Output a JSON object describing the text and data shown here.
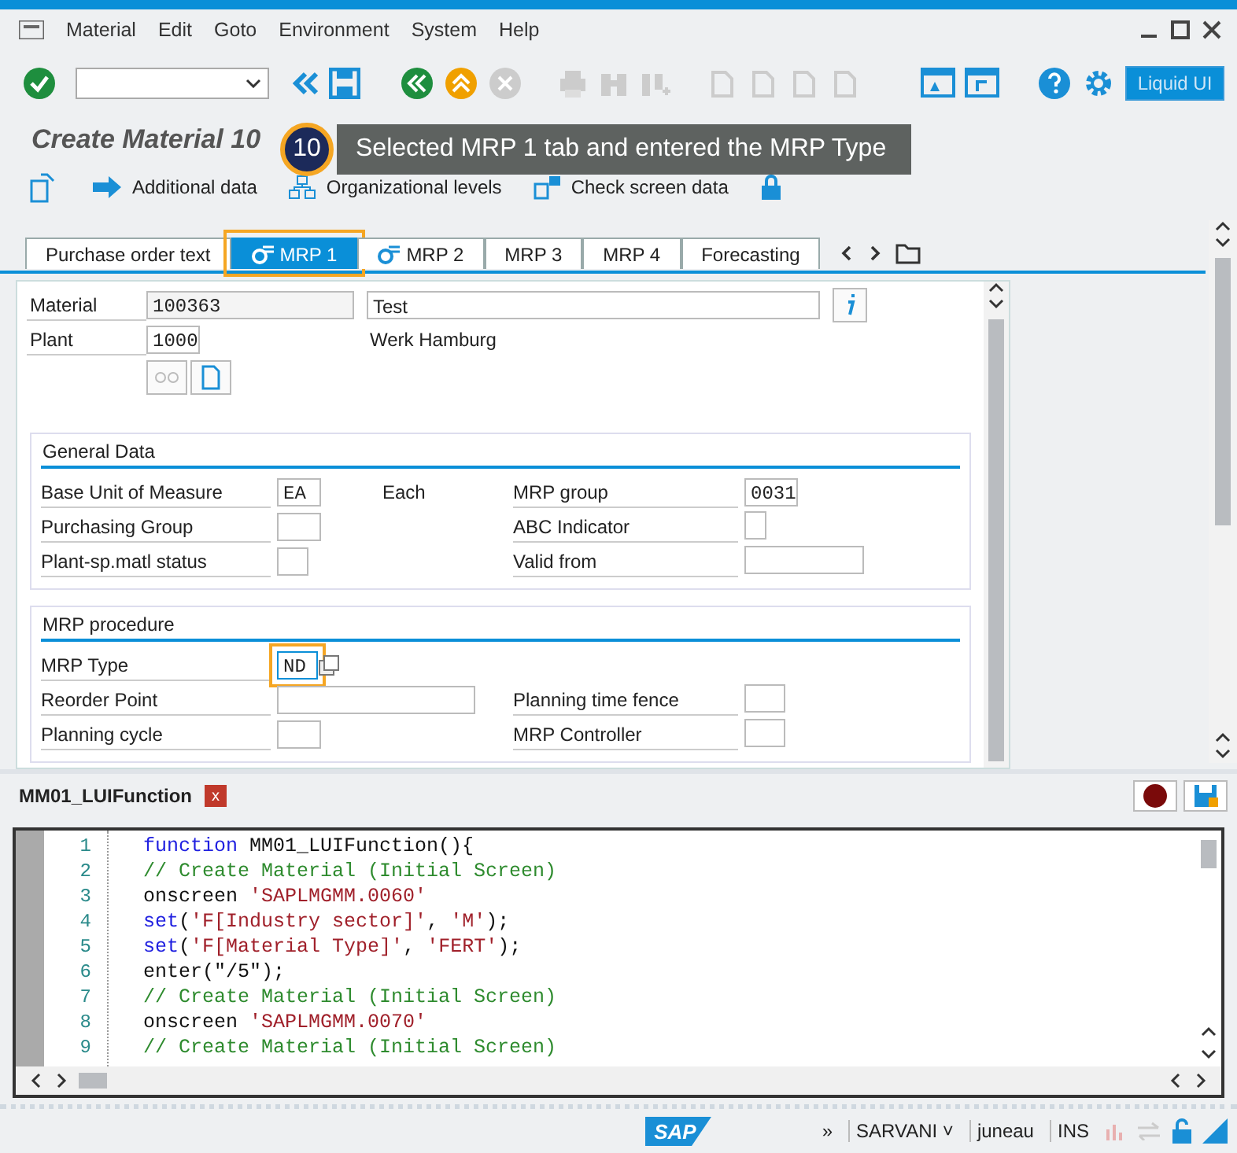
{
  "menu": [
    {
      "label": "Material"
    },
    {
      "label": "Edit"
    },
    {
      "label": "Goto"
    },
    {
      "label": "Environment"
    },
    {
      "label": "System"
    },
    {
      "label": "Help"
    }
  ],
  "toolbar": {
    "liquid_ui_button": "Liquid UI"
  },
  "title": "Create Material 10",
  "callout": {
    "step": "10",
    "text": "Selected MRP 1 tab and entered the MRP Type"
  },
  "app_toolbar": [
    {
      "label": "Additional data"
    },
    {
      "label": "Organizational levels"
    },
    {
      "label": "Check screen data"
    }
  ],
  "tabs": [
    {
      "label": "Purchase order text",
      "selected": false,
      "highlighted": false,
      "icon": false
    },
    {
      "label": "MRP 1",
      "selected": true,
      "highlighted": true,
      "icon": true
    },
    {
      "label": "MRP 2",
      "selected": false,
      "highlighted": false,
      "icon": true
    },
    {
      "label": "MRP 3",
      "selected": false,
      "highlighted": false,
      "icon": false
    },
    {
      "label": "MRP 4",
      "selected": false,
      "highlighted": false,
      "icon": false
    },
    {
      "label": "Forecasting",
      "selected": false,
      "highlighted": false,
      "icon": false
    }
  ],
  "header": {
    "material": {
      "label": "Material",
      "value": "100363",
      "description": "Test"
    },
    "plant": {
      "label": "Plant",
      "value": "1000",
      "description": "Werk Hamburg"
    }
  },
  "groups": [
    {
      "title": "General Data",
      "rows": [
        {
          "label": "Base Unit of Measure",
          "value": "EA",
          "unit": "Each",
          "right_label": "MRP group",
          "right_value": "0031",
          "highlighted": false
        },
        {
          "label": "Purchasing Group",
          "value": "",
          "right_label": "ABC Indicator",
          "right_value": "",
          "highlighted": false
        },
        {
          "label": "Plant-sp.matl status",
          "value": "",
          "right_label": "Valid from",
          "right_value": "",
          "highlighted": false
        }
      ]
    },
    {
      "title": "MRP procedure",
      "rows": [
        {
          "label": "MRP Type",
          "value": "ND",
          "highlighted": true
        },
        {
          "label": "Reorder Point",
          "value": "",
          "right_label": "Planning time fence",
          "right_value": "",
          "highlighted": false
        },
        {
          "label": "Planning cycle",
          "value": "",
          "right_label": "MRP Controller",
          "right_value": "",
          "highlighted": false
        }
      ]
    }
  ],
  "editor": {
    "tab": "MM01_LUIFunction",
    "close": "x",
    "lines": [
      {
        "number": "1",
        "segments": [
          {
            "kind": "keyword",
            "text": "function"
          },
          {
            "kind": "plain",
            "text": " MM01_LUIFunction(){"
          }
        ]
      },
      {
        "number": "2",
        "segments": [
          {
            "kind": "comment",
            "text": "// Create Material (Initial Screen)"
          }
        ]
      },
      {
        "number": "3",
        "segments": [
          {
            "kind": "plain",
            "text": "onscreen "
          },
          {
            "kind": "string",
            "text": "'SAPLMGMM.0060'"
          }
        ]
      },
      {
        "number": "4",
        "segments": [
          {
            "kind": "keyword",
            "text": "set"
          },
          {
            "kind": "plain",
            "text": "("
          },
          {
            "kind": "string",
            "text": "'F[Industry sector]'"
          },
          {
            "kind": "plain",
            "text": ", "
          },
          {
            "kind": "string",
            "text": "'M'"
          },
          {
            "kind": "plain",
            "text": ");"
          }
        ]
      },
      {
        "number": "5",
        "segments": [
          {
            "kind": "keyword",
            "text": "set"
          },
          {
            "kind": "plain",
            "text": "("
          },
          {
            "kind": "string",
            "text": "'F[Material Type]'"
          },
          {
            "kind": "plain",
            "text": ", "
          },
          {
            "kind": "string",
            "text": "'FERT'"
          },
          {
            "kind": "plain",
            "text": ");"
          }
        ]
      },
      {
        "number": "6",
        "segments": [
          {
            "kind": "plain",
            "text": "enter(\"/5\");"
          }
        ]
      },
      {
        "number": "7",
        "segments": [
          {
            "kind": "comment",
            "text": "// Create Material (Initial Screen)"
          }
        ]
      },
      {
        "number": "8",
        "segments": [
          {
            "kind": "plain",
            "text": "onscreen "
          },
          {
            "kind": "string",
            "text": "'SAPLMGMM.0070'"
          }
        ]
      },
      {
        "number": "9",
        "segments": [
          {
            "kind": "comment",
            "text": "// Create Material (Initial Screen)"
          }
        ]
      }
    ]
  },
  "status_bar": {
    "logo": "SAP",
    "more": "»",
    "user": "SARVANI",
    "caret": "˅",
    "server": "juneau",
    "mode": "INS"
  }
}
